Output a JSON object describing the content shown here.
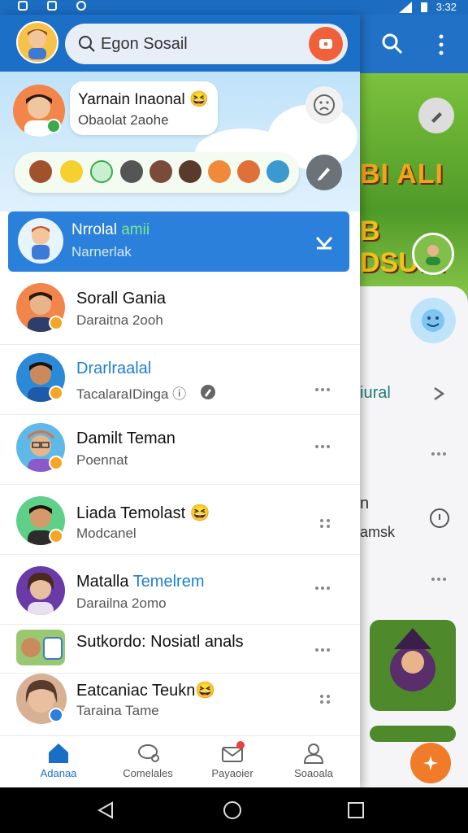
{
  "status_bar": {
    "time": "3:32"
  },
  "search": {
    "placeholder": "Egon Sosail"
  },
  "status_post": {
    "name": "Yarnain Inaonal",
    "emoji": "😆",
    "subtitle": "Obaolat 2aohe"
  },
  "active_chat": {
    "name_main": "Nrrolal",
    "name_highlight": "amii",
    "subtitle": "Narnerlak"
  },
  "chats": [
    {
      "name": "Sorall Gania",
      "name_extra": "",
      "subtitle": "Daraitna 2ooh",
      "name_color": "default"
    },
    {
      "name": "Drarlraalal",
      "name_extra": "",
      "subtitle": "TacalaraIDinga ⓘ",
      "name_color": "blue"
    },
    {
      "name": "Damilt Teman",
      "name_extra": "",
      "subtitle": "Poennat",
      "name_color": "default"
    },
    {
      "name": "Liada Temolast",
      "name_extra": "😆",
      "subtitle": "Modcanel",
      "name_color": "default"
    },
    {
      "name": "Matalla",
      "name_extra": "Temelrem",
      "subtitle": "Darailna 2omo",
      "name_color": "split"
    },
    {
      "name": "Sutkordo: Nosiatl anals",
      "name_extra": "",
      "subtitle": "",
      "name_color": "default"
    },
    {
      "name": "Eatcaniac Teukn",
      "name_extra": "😆",
      "subtitle": "Taraina Tame",
      "name_color": "default"
    }
  ],
  "bottom_nav": [
    {
      "label": "Adanaa",
      "icon": "home-icon",
      "active": true
    },
    {
      "label": "Comelales",
      "icon": "chat-bubbles-icon",
      "active": false
    },
    {
      "label": "Payaoier",
      "icon": "mail-icon",
      "active": false
    },
    {
      "label": "Soaoala",
      "icon": "profile-icon",
      "active": false
    }
  ],
  "background_app": {
    "game_title_1": "BI ALI",
    "game_title_2": "B DSUIN",
    "text_1": "iural",
    "text_2": "n",
    "text_3": "amsk"
  },
  "colors": {
    "primary": "#1c6fc7",
    "accent": "#f0603a",
    "active_chat": "#2a80db",
    "badge": "#f5a623"
  }
}
